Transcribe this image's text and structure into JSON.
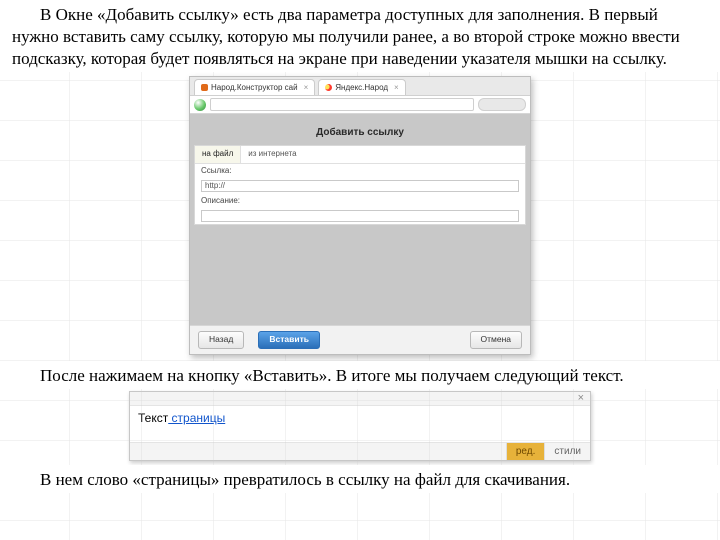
{
  "para1": "В Окне «Добавить ссылку» есть два параметра доступных для заполнения. В первый нужно вставить саму ссылку, которую мы получили ранее, а во второй строке можно ввести подсказку, которая будет появляться на экране при наведении указателя мышки на ссылку.",
  "para2": "После нажимаем на кнопку «Вставить». В итоге мы получаем следующий текст.",
  "para3": "В нем слово «страницы» превратилось в ссылку на файл для скачивания.",
  "dialog": {
    "browser_tab1": "Народ.Конструктор сай",
    "browser_tab2": "Яндекс.Народ",
    "url_text": "",
    "title": "Добавить ссылку",
    "tab_file": "на файл",
    "tab_web": "из интернета",
    "label_link": "Ссылка:",
    "value_link": "http://",
    "label_desc": "Описание:",
    "value_desc": "",
    "btn_back": "Назад",
    "btn_insert": "Вставить",
    "btn_cancel": "Отмена"
  },
  "widget": {
    "text_plain": "Текст",
    "text_link": " страницы",
    "tab_edit": "ред.",
    "tab_styles": "стили"
  }
}
